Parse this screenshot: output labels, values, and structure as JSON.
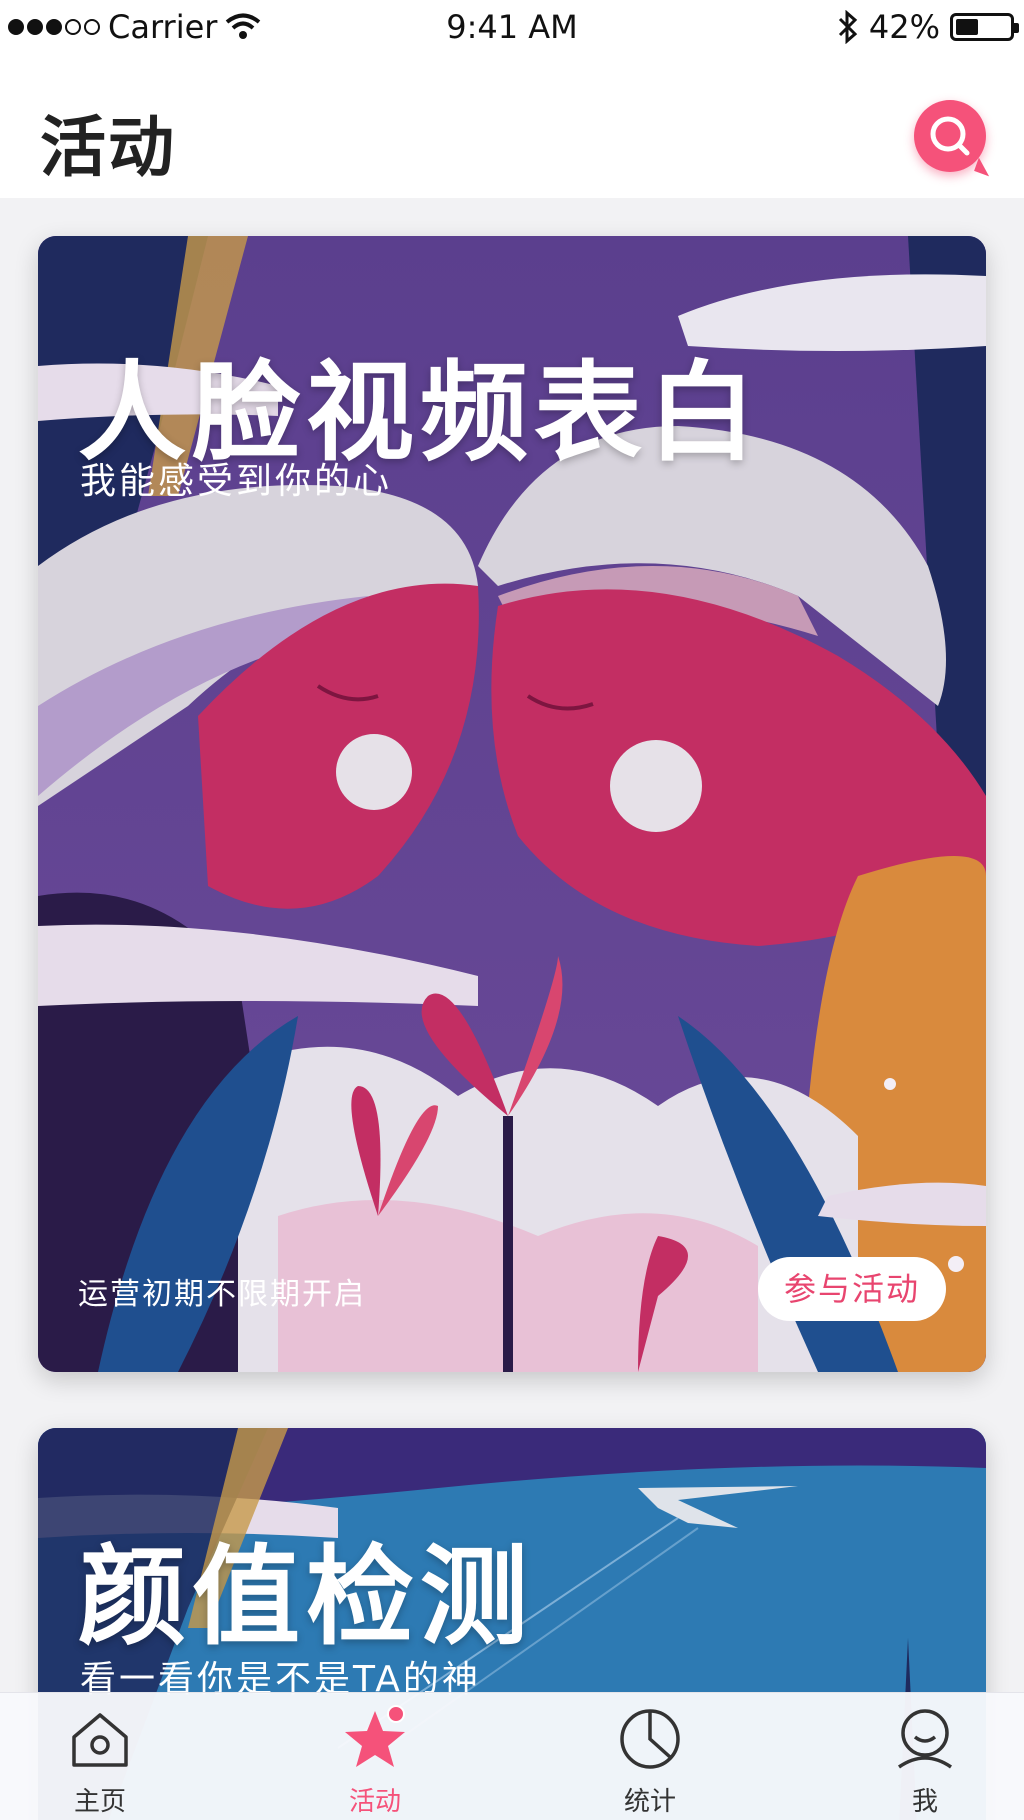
{
  "status_bar": {
    "carrier": "Carrier",
    "time": "9:41 AM",
    "battery_text": "42%",
    "battery_level": 0.42
  },
  "header": {
    "title": "活动",
    "search_icon": "search-icon",
    "accent_color": "#f5527a"
  },
  "cards": [
    {
      "title": "人脸视频表白",
      "subtitle": "我能感受到你的心",
      "note": "运营初期不限期开启",
      "button_label": "参与活动"
    },
    {
      "title": "颜值检测",
      "subtitle": "看一看你是不是TA的神"
    }
  ],
  "tab_bar": {
    "items": [
      {
        "label": "主页",
        "icon": "home-icon"
      },
      {
        "label": "活动",
        "icon": "star-icon",
        "active": true
      },
      {
        "label": "统计",
        "icon": "pie-chart-icon"
      },
      {
        "label": "我",
        "icon": "profile-icon"
      }
    ]
  }
}
